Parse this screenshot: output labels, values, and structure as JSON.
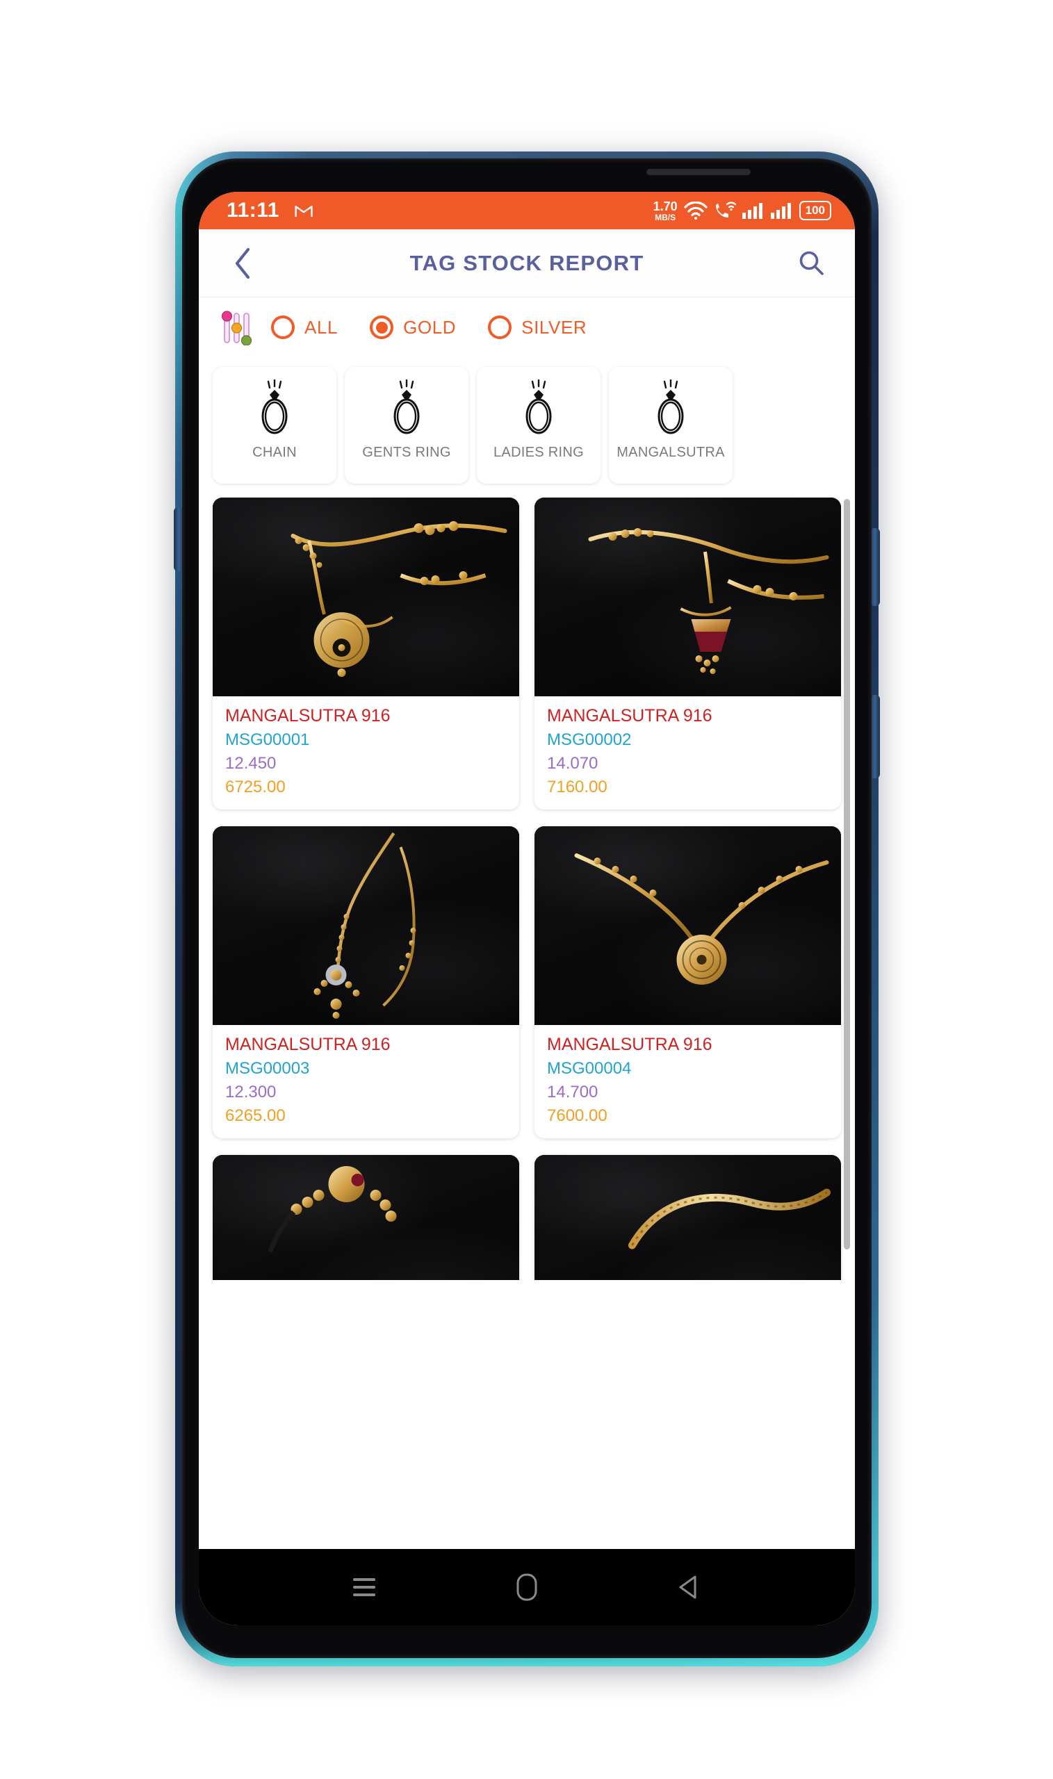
{
  "status_bar": {
    "time": "11:11",
    "gmail_icon": "gmail-icon",
    "net_speed_value": "1.70",
    "net_speed_unit": "MB/S",
    "wifi_icon": "wifi-icon",
    "wifi_calling_icon": "wifi-calling-icon",
    "signal_icon_1": "signal-bars-icon",
    "signal_icon_2": "signal-bars-icon",
    "battery_level": "100",
    "background_color": "#f05a28"
  },
  "app_bar": {
    "back_icon": "chevron-left-icon",
    "title": "TAG STOCK REPORT",
    "search_icon": "search-icon",
    "title_color": "#5a5f9e"
  },
  "filter_bar": {
    "filter_icon": "sliders-filter-icon",
    "options": [
      {
        "label": "ALL",
        "selected": false
      },
      {
        "label": "GOLD",
        "selected": true
      },
      {
        "label": "SILVER",
        "selected": false
      }
    ],
    "accent_color": "#ef5c25"
  },
  "categories": [
    {
      "label": "CHAIN",
      "icon": "ring-icon"
    },
    {
      "label": "GENTS RING",
      "icon": "ring-icon"
    },
    {
      "label": "LADIES RING",
      "icon": "ring-icon"
    },
    {
      "label": "MANGALSUTRA",
      "icon": "ring-icon"
    }
  ],
  "products": [
    {
      "title": "MANGALSUTRA 916",
      "code": "MSG00001",
      "weight": "12.450",
      "price": "6725.00",
      "image": "gold-mangalsutra-pendant-photo"
    },
    {
      "title": "MANGALSUTRA 916",
      "code": "MSG00002",
      "weight": "14.070",
      "price": "7160.00",
      "image": "gold-mangalsutra-red-pendant-photo"
    },
    {
      "title": "MANGALSUTRA 916",
      "code": "MSG00003",
      "weight": "12.300",
      "price": "6265.00",
      "image": "gold-mangalsutra-beaded-photo"
    },
    {
      "title": "MANGALSUTRA 916",
      "code": "MSG00004",
      "weight": "14.700",
      "price": "7600.00",
      "image": "gold-mangalsutra-round-pendant-photo"
    },
    {
      "title": "",
      "code": "",
      "weight": "",
      "price": "",
      "image": "gold-mangalsutra-partial-photo"
    },
    {
      "title": "",
      "code": "",
      "weight": "",
      "price": "",
      "image": "gold-chain-partial-photo"
    }
  ],
  "product_text_colors": {
    "title": "#cf2222",
    "code": "#21a4cf",
    "weight": "#9a6cc9",
    "price": "#f0a023"
  },
  "nav_bar": {
    "recents_icon": "menu-recents-icon",
    "home_icon": "home-icon",
    "back_icon": "back-triangle-icon"
  },
  "scrollbar": {
    "name": "vertical-scrollbar"
  }
}
